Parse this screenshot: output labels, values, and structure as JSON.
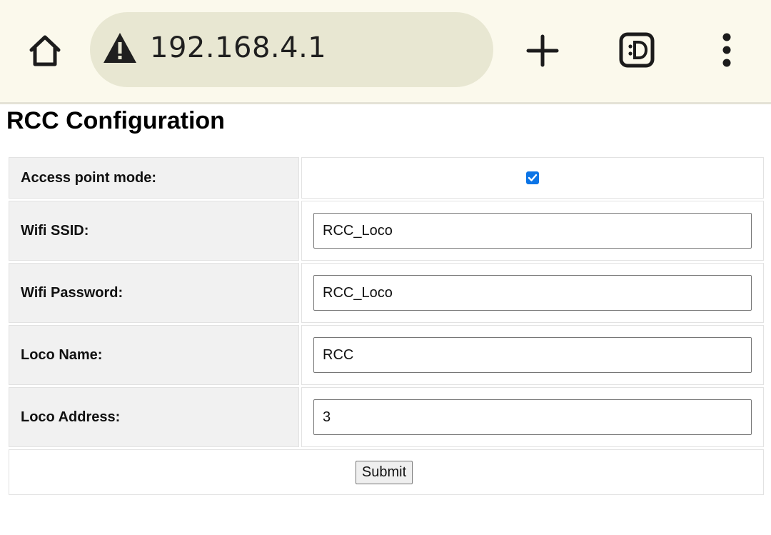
{
  "browser": {
    "url": "192.168.4.1",
    "icons": {
      "home": "home-icon",
      "warning": "warning-icon",
      "new_tab": "plus-icon",
      "tabs": "tabs-icon",
      "menu": "more-vert-icon"
    }
  },
  "page": {
    "title": "RCC Configuration"
  },
  "form": {
    "access_point": {
      "label": "Access point mode:",
      "checked": true
    },
    "ssid": {
      "label": "Wifi SSID:",
      "value": "RCC_Loco"
    },
    "password": {
      "label": "Wifi Password:",
      "value": "RCC_Loco"
    },
    "loco_name": {
      "label": "Loco Name:",
      "value": "RCC"
    },
    "loco_address": {
      "label": "Loco Address:",
      "value": "3"
    },
    "submit_label": "Submit"
  },
  "colors": {
    "toolbar_bg": "#fbf9ec",
    "urlbar_bg": "#e8e7d2",
    "checkbox_accent": "#0b74e6",
    "label_cell_bg": "#f1f1f1"
  }
}
